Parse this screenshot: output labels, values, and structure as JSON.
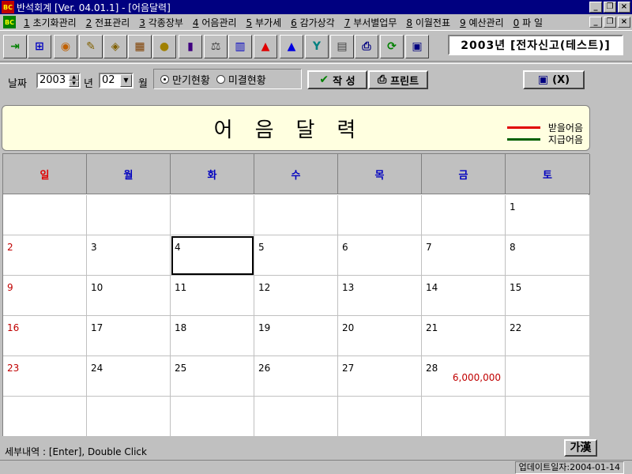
{
  "window": {
    "title": "반석회계 [Ver. 04.01.1] - [어음달력]",
    "app_icon_text": "BC"
  },
  "menu": {
    "items": [
      {
        "key": "1",
        "label": " 초기화관리"
      },
      {
        "key": "2",
        "label": " 전표관리"
      },
      {
        "key": "3",
        "label": " 각종장부"
      },
      {
        "key": "4",
        "label": " 어음관리"
      },
      {
        "key": "5",
        "label": " 부가세"
      },
      {
        "key": "6",
        "label": " 감가상각"
      },
      {
        "key": "7",
        "label": " 부서별업무"
      },
      {
        "key": "8",
        "label": " 이월전표"
      },
      {
        "key": "9",
        "label": " 예산관리"
      },
      {
        "key": "0",
        "label": " 파 일"
      }
    ]
  },
  "toolbar": {
    "buttons": [
      {
        "name": "exit-door-icon",
        "glyph": "⇥",
        "color": "#008000"
      },
      {
        "name": "org-chart-icon",
        "glyph": "⊞",
        "color": "#0000c0"
      },
      {
        "name": "globe-icon",
        "glyph": "◉",
        "color": "#c06000"
      },
      {
        "name": "pencil-book-icon",
        "glyph": "✎",
        "color": "#806000"
      },
      {
        "name": "tag-icon",
        "glyph": "◈",
        "color": "#806000"
      },
      {
        "name": "abacus-icon",
        "glyph": "▦",
        "color": "#804000"
      },
      {
        "name": "coin-icon",
        "glyph": "●",
        "color": "#a08000"
      },
      {
        "name": "book-icon",
        "glyph": "▮",
        "color": "#400080"
      },
      {
        "name": "scale-icon",
        "glyph": "⚖",
        "color": "#404040"
      },
      {
        "name": "bars-icon",
        "glyph": "▥",
        "color": "#0000c0"
      },
      {
        "name": "arrow-up-red-icon",
        "glyph": "▲",
        "color": "#e00000"
      },
      {
        "name": "arrow-up-blue-icon",
        "glyph": "▲",
        "color": "#0000e0"
      },
      {
        "name": "year-icon",
        "glyph": "Y",
        "color": "#008080"
      },
      {
        "name": "calculator-icon",
        "glyph": "▤",
        "color": "#404040"
      },
      {
        "name": "printer-icon",
        "glyph": "⎙",
        "color": "#000080"
      },
      {
        "name": "refresh-icon",
        "glyph": "⟳",
        "color": "#008000"
      },
      {
        "name": "window-icon",
        "glyph": "▣",
        "color": "#000080"
      }
    ],
    "year_display": "2003년 [전자신고(테스트)]"
  },
  "filter": {
    "date_label": "날짜",
    "year_value": "2003",
    "year_unit": "년",
    "month_value": "02",
    "month_unit": "월",
    "radio_maturity": "만기현황",
    "radio_unsettled": "미결현황",
    "selected_radio": "maturity",
    "create_button": "작 성",
    "print_button": "프린트",
    "exit_button": "(X)"
  },
  "header": {
    "title": "어음달력",
    "legend": [
      {
        "label": "받을어음",
        "color": "#e00000"
      },
      {
        "label": "지급어음",
        "color": "#006000"
      }
    ]
  },
  "calendar": {
    "weekdays": [
      {
        "label": "일",
        "color": "#e00000"
      },
      {
        "label": "월",
        "color": "#0000c0"
      },
      {
        "label": "화",
        "color": "#0000c0"
      },
      {
        "label": "수",
        "color": "#0000c0"
      },
      {
        "label": "목",
        "color": "#0000c0"
      },
      {
        "label": "금",
        "color": "#0000c0"
      },
      {
        "label": "토",
        "color": "#0000c0"
      }
    ],
    "weeks": [
      [
        "",
        "",
        "",
        "",
        "",
        "",
        "1"
      ],
      [
        "2",
        "3",
        "4",
        "5",
        "6",
        "7",
        "8"
      ],
      [
        "9",
        "10",
        "11",
        "12",
        "13",
        "14",
        "15"
      ],
      [
        "16",
        "17",
        "18",
        "19",
        "20",
        "21",
        "22"
      ],
      [
        "23",
        "24",
        "25",
        "26",
        "27",
        "28",
        ""
      ],
      [
        "",
        "",
        "",
        "",
        "",
        "",
        ""
      ]
    ],
    "selected_day": "4",
    "amounts": {
      "28": "6,000,000"
    },
    "sunday_color": "#c00000"
  },
  "status": {
    "hint": "세부내역 : [Enter], Double Click",
    "hanja_button": "가漢",
    "update_date": "업데이트일자:2004-01-14"
  }
}
